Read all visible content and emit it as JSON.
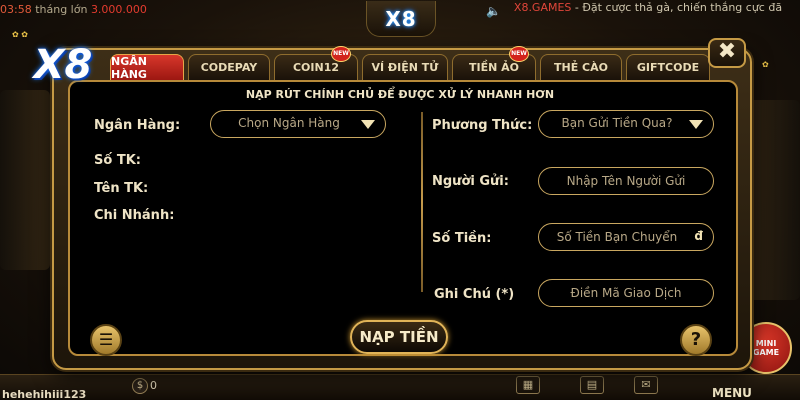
{
  "background": {
    "ticker_left_time": "03:58",
    "ticker_left_text": "tháng lớn",
    "ticker_left_amount": "3.000.000",
    "top_logo": "X8",
    "ticker_right_brand": "X8.GAMES",
    "ticker_right_text": " - Đặt cược thả gà, chiến thắng cực đã",
    "username": "hehehihiii123",
    "balance": "0",
    "menu_label": "MENU",
    "mini_game_label": "MINI GAME"
  },
  "modal": {
    "brand_logo": "X8",
    "close_label": "✖",
    "tabs": [
      {
        "label": "NGÂN HÀNG",
        "active": true,
        "new": false
      },
      {
        "label": "CODEPAY",
        "active": false,
        "new": false
      },
      {
        "label": "COIN12",
        "active": false,
        "new": true
      },
      {
        "label": "VÍ ĐIỆN TỬ",
        "active": false,
        "new": false
      },
      {
        "label": "TIỀN ẢO",
        "active": false,
        "new": true
      },
      {
        "label": "THẺ CÀO",
        "active": false,
        "new": false
      },
      {
        "label": "GIFTCODE",
        "active": false,
        "new": false
      }
    ],
    "new_badge": "NEW",
    "notice": "NẠP RÚT CHÍNH CHỦ ĐỂ ĐƯỢC XỬ LÝ NHANH HƠN",
    "left": {
      "bank_label": "Ngân Hàng:",
      "bank_select": "Chọn Ngân Hàng",
      "account_no_label": "Số TK:",
      "account_name_label": "Tên TK:",
      "branch_label": "Chi Nhánh:"
    },
    "right": {
      "method_label": "Phương Thức:",
      "method_select": "Bạn Gửi Tiền Qua?",
      "sender_label": "Người Gửi:",
      "sender_placeholder": "Nhập Tên Người Gửi",
      "amount_label": "Số Tiền:",
      "amount_placeholder": "Số Tiền Bạn Chuyển",
      "amount_suffix": "đ",
      "note_label": "Ghi Chú (*)",
      "note_placeholder": "Điền Mã Giao Dịch"
    },
    "submit_label": "NẠP TIỀN",
    "help_label": "?"
  }
}
